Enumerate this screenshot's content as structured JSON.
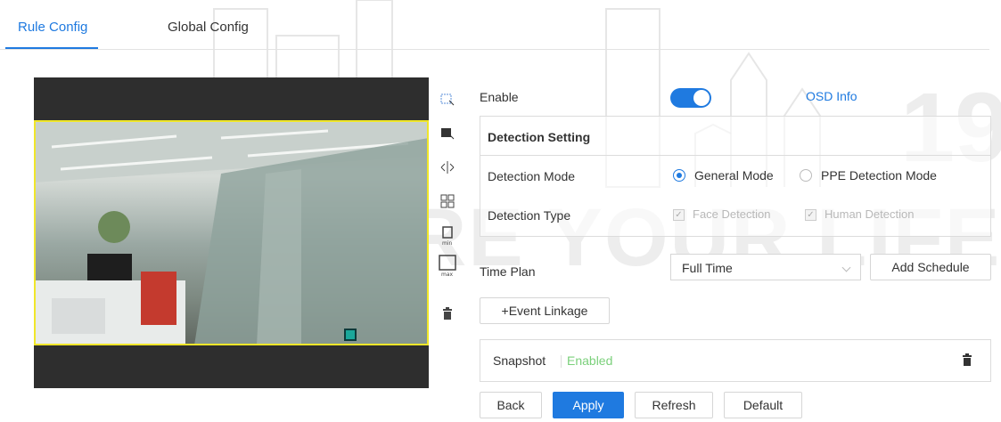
{
  "tabs": [
    {
      "label": "Rule Config",
      "active": true
    },
    {
      "label": "Global Config",
      "active": false
    }
  ],
  "watermark": {
    "text": "CURE YOUR LIFE",
    "number": "19"
  },
  "toolbar_icons": [
    "draw-area-icon",
    "draw-excluded-area-icon",
    "direction-icon",
    "pixel-counter-icon",
    "min-size-icon",
    "max-size-icon",
    "delete-icon"
  ],
  "enable": {
    "label": "Enable",
    "on": true,
    "osd_link": "OSD Info"
  },
  "detection": {
    "title": "Detection Setting",
    "mode_label": "Detection Mode",
    "modes": [
      {
        "label": "General Mode",
        "selected": true
      },
      {
        "label": "PPE Detection Mode",
        "selected": false
      }
    ],
    "type_label": "Detection Type",
    "types": [
      {
        "label": "Face Detection",
        "checked": true
      },
      {
        "label": "Human Detection",
        "checked": true
      }
    ]
  },
  "time_plan": {
    "label": "Time Plan",
    "value": "Full Time",
    "add_schedule": "Add Schedule"
  },
  "event_linkage": "+Event Linkage",
  "snapshot": {
    "label": "Snapshot",
    "status": "Enabled"
  },
  "buttons": {
    "back": "Back",
    "apply": "Apply",
    "refresh": "Refresh",
    "default": "Default"
  },
  "colors": {
    "accent": "#1f7ae0",
    "enabled_text": "#7bd07b",
    "frame": "#f0e62a"
  }
}
